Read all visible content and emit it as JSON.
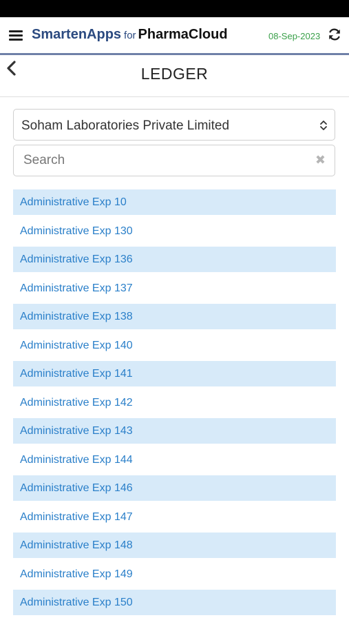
{
  "header": {
    "brand_name": "SmartenApps",
    "brand_for": "for",
    "brand_product": "PharmaCloud",
    "date": "08-Sep-2023",
    "menu_icon": "hamburger-menu-icon",
    "refresh_icon": "refresh-icon"
  },
  "page": {
    "title": "LEDGER",
    "back_icon": "chevron-left-icon"
  },
  "company_select": {
    "value": "Soham Laboratories Private Limited",
    "icon": "sort-updown-icon"
  },
  "search": {
    "placeholder": "Search",
    "value": "",
    "clear_icon": "close-icon"
  },
  "colors": {
    "brand": "#2b4a80",
    "date": "#3aa04a",
    "link": "#2a7fc9",
    "row_shade": "#d7eaf9",
    "header_rule": "#6f80a8"
  },
  "ledgers": [
    {
      "label": "Administrative Exp 10"
    },
    {
      "label": "Administrative Exp 130"
    },
    {
      "label": "Administrative Exp 136"
    },
    {
      "label": "Administrative Exp 137"
    },
    {
      "label": "Administrative Exp 138"
    },
    {
      "label": "Administrative Exp 140"
    },
    {
      "label": "Administrative Exp 141"
    },
    {
      "label": "Administrative Exp 142"
    },
    {
      "label": "Administrative Exp 143"
    },
    {
      "label": "Administrative Exp 144"
    },
    {
      "label": "Administrative Exp 146"
    },
    {
      "label": "Administrative Exp 147"
    },
    {
      "label": "Administrative Exp 148"
    },
    {
      "label": "Administrative Exp 149"
    },
    {
      "label": "Administrative Exp 150"
    }
  ]
}
